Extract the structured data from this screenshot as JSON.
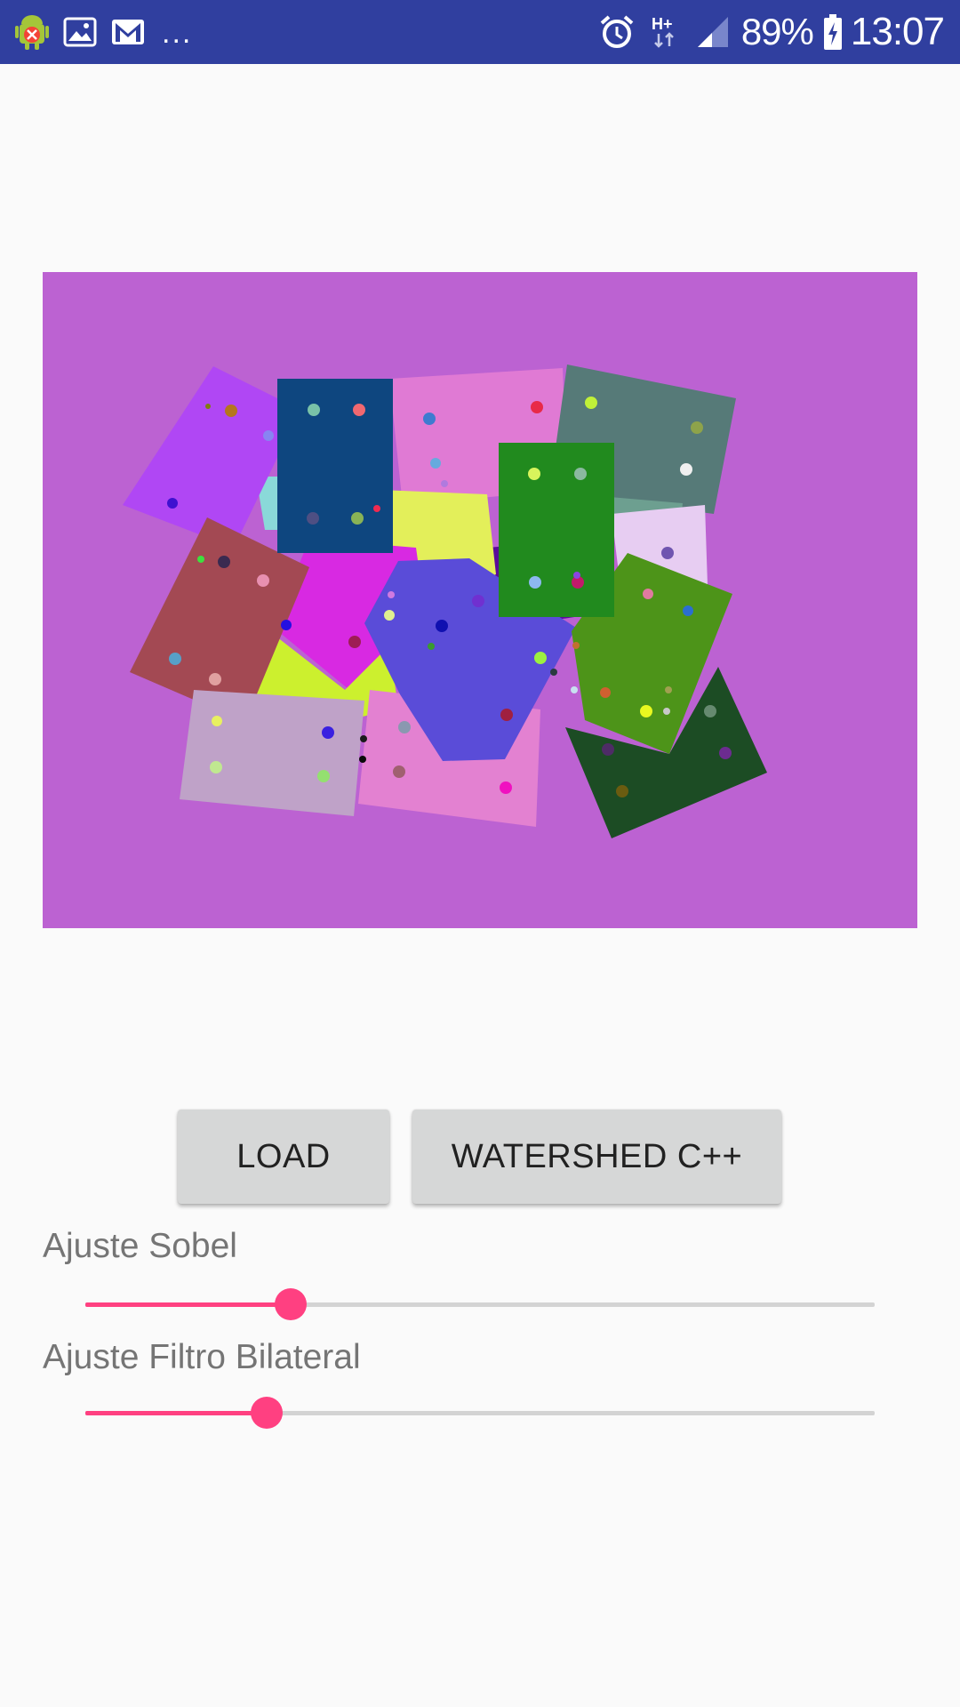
{
  "status_bar": {
    "left_icons": [
      "android-debug-icon",
      "image-icon",
      "gmail-icon"
    ],
    "more_notifications": "...",
    "right_icons": [
      "alarm-icon",
      "network-hplus-icon",
      "signal-icon"
    ],
    "battery_percent": "89%",
    "time": "13:07",
    "background_color": "#303f9f"
  },
  "image_view": {
    "description_color": "#bc62d2"
  },
  "buttons": {
    "load_label": "LOAD",
    "watershed_label": "WATERSHED C++"
  },
  "sliders": {
    "sobel": {
      "label": "Ajuste Sobel",
      "value_fraction": 0.26
    },
    "bilateral": {
      "label": "Ajuste Filtro Bilateral",
      "value_fraction": 0.23
    },
    "accent_color": "#ff4081"
  }
}
